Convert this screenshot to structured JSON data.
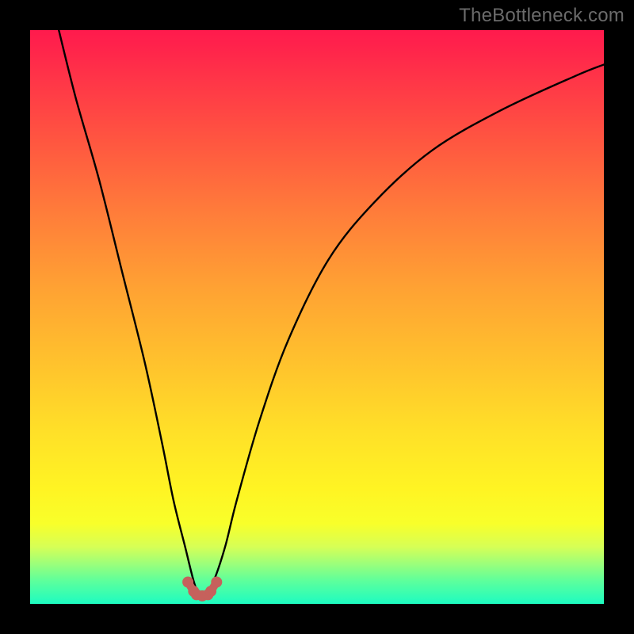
{
  "watermark": "TheBottleneck.com",
  "chart_data": {
    "type": "line",
    "title": "",
    "xlabel": "",
    "ylabel": "",
    "xlim": [
      0,
      100
    ],
    "ylim": [
      0,
      100
    ],
    "gradient_stops": [
      {
        "pos": 0,
        "color": "#ff1a4d"
      },
      {
        "pos": 8,
        "color": "#ff3348"
      },
      {
        "pos": 20,
        "color": "#ff5840"
      },
      {
        "pos": 32,
        "color": "#ff7d3a"
      },
      {
        "pos": 45,
        "color": "#ffa233"
      },
      {
        "pos": 58,
        "color": "#ffc22d"
      },
      {
        "pos": 70,
        "color": "#ffe028"
      },
      {
        "pos": 80,
        "color": "#fff423"
      },
      {
        "pos": 86,
        "color": "#f8ff2a"
      },
      {
        "pos": 90,
        "color": "#d7ff55"
      },
      {
        "pos": 93,
        "color": "#9cff7a"
      },
      {
        "pos": 96,
        "color": "#5dff9c"
      },
      {
        "pos": 100,
        "color": "#1dfcc1"
      }
    ],
    "series": [
      {
        "name": "curve",
        "color": "#000000",
        "x": [
          5,
          8,
          12,
          16,
          20,
          23,
          25,
          27,
          28.5,
          29.5,
          30.5,
          32,
          34,
          36,
          40,
          45,
          52,
          60,
          70,
          82,
          95,
          100
        ],
        "y": [
          100,
          88,
          74,
          58,
          42,
          28,
          18,
          10,
          4,
          1.5,
          1.5,
          4,
          10,
          18,
          32,
          46,
          60,
          70,
          79,
          86,
          92,
          94
        ]
      },
      {
        "name": "trough-markers",
        "color": "#c6615c",
        "marker": "circle",
        "x": [
          27.5,
          28.5,
          29,
          30,
          31,
          31.5,
          32.5
        ],
        "y": [
          3.8,
          2.2,
          1.6,
          1.4,
          1.6,
          2.2,
          3.8
        ]
      }
    ],
    "trough": {
      "x": 30,
      "y": 1.4
    }
  }
}
